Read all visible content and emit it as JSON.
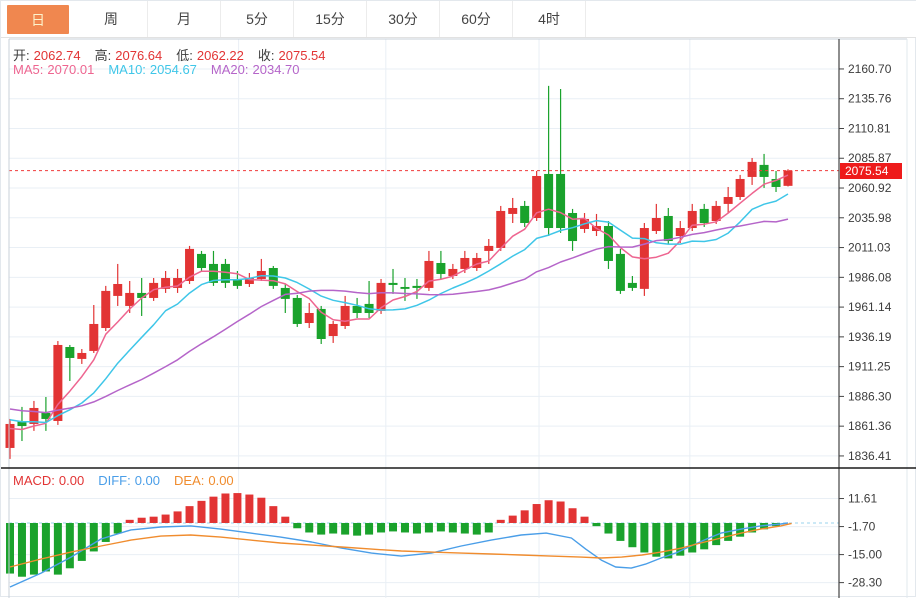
{
  "tabs": {
    "items": [
      {
        "label": "日",
        "active": true
      },
      {
        "label": "周",
        "active": false
      },
      {
        "label": "月",
        "active": false
      },
      {
        "label": "5分",
        "active": false
      },
      {
        "label": "15分",
        "active": false
      },
      {
        "label": "30分",
        "active": false
      },
      {
        "label": "60分",
        "active": false
      },
      {
        "label": "4时",
        "active": false
      }
    ]
  },
  "ohlc": {
    "open_label": "开:",
    "open": "2062.74",
    "high_label": "高:",
    "high": "2076.64",
    "low_label": "低:",
    "low": "2062.22",
    "close_label": "收:",
    "close": "2075.54"
  },
  "ma": {
    "ma5_label": "MA5:",
    "ma5": "2070.01",
    "ma10_label": "MA10:",
    "ma10": "2054.67",
    "ma20_label": "MA20:",
    "ma20": "2034.70"
  },
  "macd_header": {
    "macd_label": "MACD:",
    "macd": "0.00",
    "diff_label": "DIFF:",
    "diff": "0.00",
    "dea_label": "DEA:",
    "dea": "0.00"
  },
  "price_axis": {
    "current_price_label": "2075.54"
  },
  "colors": {
    "up": "#e23434",
    "down": "#1aa22c",
    "ma5": "#ee6590",
    "ma10": "#3fc6e8",
    "ma20": "#b565c9",
    "diff": "#4a9ee8",
    "dea": "#f08c2e",
    "tab_active_bg": "#f0874f",
    "price_tag_bg": "#ee1b1b",
    "dotted_price_line": "#f03b3b",
    "macd_zero_dash": "#aedcf0",
    "grid": "#e9eff5",
    "axis_line": "#444444",
    "separator": "#1b1b1b",
    "tick_text": "#3c3c3c"
  },
  "chart_data": {
    "type": "candlestick+macd",
    "title": "",
    "price_ticks": [
      2160.7,
      2135.76,
      2110.81,
      2085.87,
      2060.92,
      2035.98,
      2011.03,
      1986.08,
      1961.14,
      1936.19,
      1911.25,
      1886.3,
      1861.36,
      1836.41
    ],
    "current_price": 2075.54,
    "main_ylim": [
      1826.3,
      2185.8
    ],
    "ma_periods": [
      5,
      10,
      20
    ],
    "ma_seed": [
      1893,
      1891,
      1889,
      1887,
      1886,
      1885,
      1884,
      1883,
      1882,
      1881,
      1880,
      1878,
      1876,
      1874,
      1872,
      1870,
      1866,
      1862,
      1856,
      1850
    ],
    "x_grid_indices": [
      19.1,
      31.4,
      44.2,
      56.8
    ],
    "candles": [
      [
        1843.1,
        1867.4,
        1833.9,
        1863.2
      ],
      [
        1865.7,
        1877.5,
        1848.9,
        1861.5
      ],
      [
        1863.2,
        1882.5,
        1857.4,
        1876.6
      ],
      [
        1872.4,
        1885.8,
        1857.4,
        1867.4
      ],
      [
        1865.7,
        1932.7,
        1862.4,
        1929.4
      ],
      [
        1927.7,
        1929.4,
        1899.2,
        1918.5
      ],
      [
        1917.7,
        1926.0,
        1913.5,
        1922.7
      ],
      [
        1924.4,
        1962.9,
        1922.7,
        1947.0
      ],
      [
        1943.6,
        1978.9,
        1941.1,
        1974.7
      ],
      [
        1970.5,
        1997.3,
        1962.1,
        1980.5
      ],
      [
        1962.1,
        1983.0,
        1956.2,
        1973.0
      ],
      [
        1973.0,
        1985.5,
        1953.7,
        1968.8
      ],
      [
        1968.8,
        1985.5,
        1966.3,
        1981.4
      ],
      [
        1976.4,
        1991.4,
        1973.0,
        1985.5
      ],
      [
        1977.2,
        1993.1,
        1973.0,
        1985.5
      ],
      [
        1983.0,
        2012.4,
        1980.5,
        2009.9
      ],
      [
        2005.7,
        2008.2,
        1991.4,
        1993.9
      ],
      [
        1997.3,
        2008.2,
        1978.9,
        1981.4
      ],
      [
        1997.3,
        2001.5,
        1977.2,
        1981.4
      ],
      [
        1984.7,
        1991.4,
        1976.4,
        1978.9
      ],
      [
        1980.5,
        1989.7,
        1978.0,
        1985.5
      ],
      [
        1984.7,
        2001.5,
        1983.0,
        1991.4
      ],
      [
        1993.9,
        1995.6,
        1976.4,
        1978.9
      ],
      [
        1977.2,
        1980.5,
        1956.2,
        1968.0
      ],
      [
        1968.8,
        1971.3,
        1944.5,
        1947.0
      ],
      [
        1947.8,
        1964.6,
        1943.6,
        1956.2
      ],
      [
        1959.6,
        1962.1,
        1930.2,
        1934.4
      ],
      [
        1936.9,
        1949.5,
        1931.1,
        1947.0
      ],
      [
        1945.3,
        1970.5,
        1942.8,
        1962.1
      ],
      [
        1962.1,
        1968.8,
        1952.0,
        1956.2
      ],
      [
        1963.8,
        1983.0,
        1952.0,
        1956.2
      ],
      [
        1957.9,
        1984.7,
        1955.4,
        1981.4
      ],
      [
        1981.4,
        1993.1,
        1972.2,
        1979.7
      ],
      [
        1978.0,
        1985.5,
        1966.3,
        1976.4
      ],
      [
        1978.9,
        1984.7,
        1968.0,
        1977.2
      ],
      [
        1977.2,
        2008.2,
        1974.7,
        1999.8
      ],
      [
        1998.1,
        2008.2,
        1984.7,
        1988.9
      ],
      [
        1987.2,
        1997.3,
        1984.7,
        1993.1
      ],
      [
        1993.1,
        2008.2,
        1989.7,
        2002.3
      ],
      [
        1993.9,
        2006.5,
        1991.4,
        2002.3
      ],
      [
        2008.2,
        2018.2,
        1997.3,
        2012.4
      ],
      [
        2010.7,
        2045.9,
        2008.2,
        2041.7
      ],
      [
        2039.2,
        2052.6,
        2031.6,
        2044.2
      ],
      [
        2045.9,
        2050.1,
        2028.3,
        2031.6
      ],
      [
        2035.8,
        2075.2,
        2033.3,
        2071.0
      ],
      [
        2072.7,
        2146.5,
        2020.7,
        2027.4
      ],
      [
        2072.7,
        2143.9,
        2023.3,
        2027.4
      ],
      [
        2040.0,
        2043.4,
        2008.2,
        2016.5
      ],
      [
        2026.6,
        2040.0,
        2023.3,
        2035.0
      ],
      [
        2024.9,
        2039.2,
        2020.7,
        2029.1
      ],
      [
        2029.1,
        2033.3,
        1993.1,
        1999.8
      ],
      [
        2005.7,
        2009.9,
        1972.2,
        1974.7
      ],
      [
        1981.4,
        1987.2,
        1974.7,
        1977.2
      ],
      [
        1976.4,
        2031.6,
        1970.5,
        2027.4
      ],
      [
        2024.9,
        2047.6,
        2022.4,
        2035.8
      ],
      [
        2037.5,
        2044.2,
        2014.0,
        2016.5
      ],
      [
        2020.7,
        2033.3,
        2014.9,
        2027.4
      ],
      [
        2027.4,
        2047.6,
        2024.9,
        2041.7
      ],
      [
        2043.4,
        2047.6,
        2028.3,
        2031.6
      ],
      [
        2033.3,
        2050.1,
        2030.8,
        2045.9
      ],
      [
        2047.6,
        2061.8,
        2040.0,
        2053.4
      ],
      [
        2053.4,
        2071.9,
        2050.9,
        2068.5
      ],
      [
        2070.2,
        2086.1,
        2063.5,
        2082.8
      ],
      [
        2080.3,
        2089.5,
        2061.0,
        2070.2
      ],
      [
        2068.5,
        2075.2,
        2057.6,
        2061.8
      ],
      [
        2062.74,
        2076.64,
        2062.22,
        2075.54
      ]
    ],
    "macd": {
      "ticks": [
        11.61,
        -1.7,
        -15.0,
        -28.3
      ],
      "ylim": [
        -35.6,
        26.1
      ],
      "histogram": [
        -24,
        -25.5,
        -24.5,
        -23,
        -24.5,
        -21.5,
        -18,
        -13.5,
        -9,
        -5,
        1.5,
        2.5,
        3,
        4,
        5.5,
        8,
        10.5,
        12.5,
        14,
        14.2,
        13.5,
        12,
        8,
        3,
        -2.5,
        -4.5,
        -5.5,
        -5,
        -5.5,
        -6,
        -5.5,
        -4.5,
        -4,
        -4.5,
        -5,
        -4.5,
        -4,
        -4.5,
        -5,
        -5.5,
        -4.5,
        1.5,
        3.5,
        6,
        9,
        10.8,
        10.2,
        7,
        3,
        -1.5,
        -5,
        -8.5,
        -11.5,
        -14,
        -16,
        -16.8,
        -15.5,
        -14,
        -12.5,
        -10.5,
        -8.5,
        -6.5,
        -4.5,
        -3,
        -1.5,
        0
      ],
      "diff": [
        [
          0,
          -30.4
        ],
        [
          2.6,
          -23.8
        ],
        [
          5.1,
          -16.2
        ],
        [
          7.6,
          -7.6
        ],
        [
          10.1,
          -3.3
        ],
        [
          12.6,
          -1.9
        ],
        [
          15.1,
          -1.4
        ],
        [
          17.6,
          -2.9
        ],
        [
          20.1,
          -4.8
        ],
        [
          22.6,
          -6.7
        ],
        [
          25.2,
          -9
        ],
        [
          27.7,
          -11.9
        ],
        [
          30.2,
          -14.3
        ],
        [
          32.7,
          -15.7
        ],
        [
          35.2,
          -14.3
        ],
        [
          37.7,
          -10.9
        ],
        [
          40.2,
          -8.1
        ],
        [
          42.7,
          -5.7
        ],
        [
          44.8,
          -4.8
        ],
        [
          46.9,
          -7.1
        ],
        [
          48.1,
          -12.4
        ],
        [
          49.4,
          -17.6
        ],
        [
          50.6,
          -20.9
        ],
        [
          51.9,
          -21.4
        ],
        [
          53.1,
          -19.5
        ],
        [
          54.4,
          -16.6
        ],
        [
          55.6,
          -14.3
        ],
        [
          56.9,
          -10.9
        ],
        [
          58.2,
          -7.6
        ],
        [
          59.4,
          -4.8
        ],
        [
          61.1,
          -2.9
        ],
        [
          62.7,
          -1.4
        ],
        [
          64.4,
          -0.5
        ],
        [
          65,
          0
        ]
      ],
      "dea": [
        [
          0,
          -20.9
        ],
        [
          2.6,
          -17.1
        ],
        [
          5.1,
          -13.8
        ],
        [
          7.6,
          -10.9
        ],
        [
          10.1,
          -8.1
        ],
        [
          12.6,
          -6.2
        ],
        [
          15.1,
          -5.7
        ],
        [
          17.6,
          -6.7
        ],
        [
          20.1,
          -8.1
        ],
        [
          22.6,
          -9.5
        ],
        [
          25.2,
          -10.5
        ],
        [
          27.7,
          -11.4
        ],
        [
          30.2,
          -12.4
        ],
        [
          32.7,
          -13.3
        ],
        [
          35.2,
          -13.8
        ],
        [
          37.7,
          -14.3
        ],
        [
          40.2,
          -14.7
        ],
        [
          42.7,
          -15.2
        ],
        [
          45.2,
          -15.7
        ],
        [
          47.7,
          -16.2
        ],
        [
          49.4,
          -16.6
        ],
        [
          51.1,
          -16.2
        ],
        [
          52.8,
          -15.2
        ],
        [
          54.4,
          -13.8
        ],
        [
          56.1,
          -11.9
        ],
        [
          57.7,
          -9.5
        ],
        [
          59.4,
          -7.1
        ],
        [
          61.1,
          -4.8
        ],
        [
          62.7,
          -2.9
        ],
        [
          64.4,
          -1.4
        ],
        [
          65.3,
          -0.2
        ]
      ]
    }
  }
}
